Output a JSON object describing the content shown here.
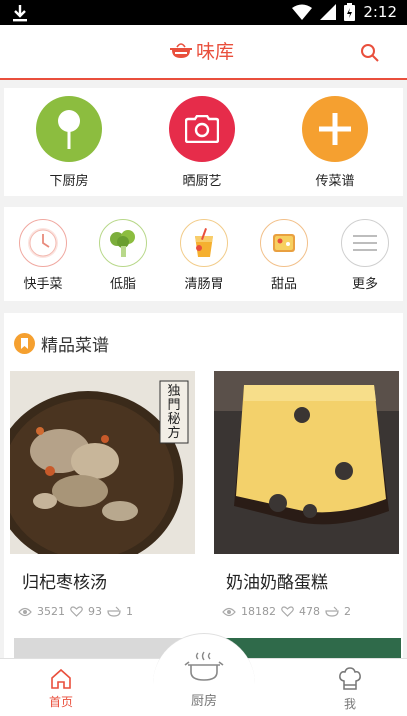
{
  "status_bar": {
    "time": "2:12"
  },
  "header": {
    "title": "味库"
  },
  "quick_actions": [
    {
      "label": "下厨房",
      "icon": "lollipop-icon",
      "color": "#8cbd3f"
    },
    {
      "label": "晒厨艺",
      "icon": "camera-icon",
      "color": "#e62c4a"
    },
    {
      "label": "传菜谱",
      "icon": "plus-icon",
      "color": "#f5a030"
    }
  ],
  "categories": [
    {
      "label": "快手菜",
      "icon": "clock-icon"
    },
    {
      "label": "低脂",
      "icon": "broccoli-icon"
    },
    {
      "label": "清肠胃",
      "icon": "drink-icon"
    },
    {
      "label": "甜品",
      "icon": "cake-icon"
    },
    {
      "label": "更多",
      "icon": "more-icon"
    }
  ],
  "featured": {
    "title": "精品菜谱",
    "recipes": [
      {
        "title": "归杞枣核汤",
        "views": "3521",
        "likes": "93",
        "collects": "1",
        "stamp": "独門秘方"
      },
      {
        "title": "奶油奶酪蛋糕",
        "views": "18182",
        "likes": "478",
        "collects": "2"
      }
    ]
  },
  "tabbar": [
    {
      "label": "首页",
      "icon": "home-icon",
      "active": true
    },
    {
      "label": "厨房",
      "icon": "pot-icon",
      "active": false
    },
    {
      "label": "我",
      "icon": "chef-hat-icon",
      "active": false
    }
  ],
  "colors": {
    "accent": "#e94f3c"
  }
}
